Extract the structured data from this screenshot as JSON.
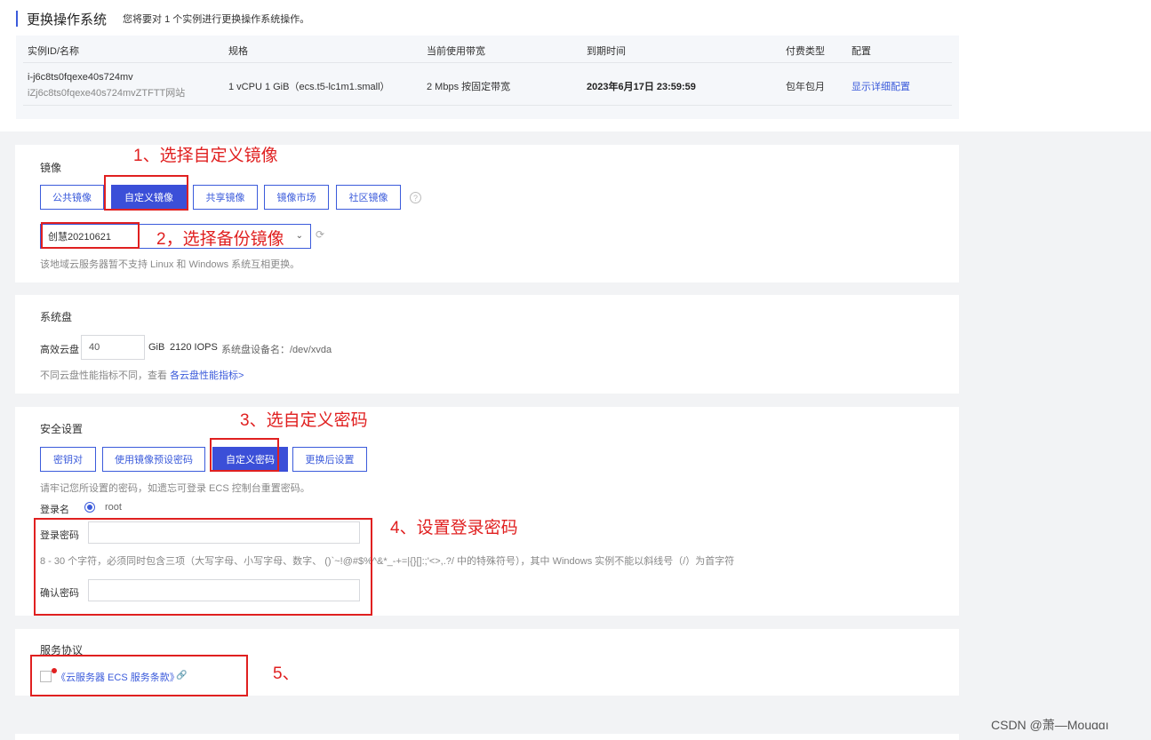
{
  "header": {
    "title": "更换操作系统",
    "subtitle": "您将要对 1 个实例进行更换操作系统操作。"
  },
  "instance_table": {
    "columns": [
      "实例ID/名称",
      "规格",
      "当前使用带宽",
      "到期时间",
      "付费类型",
      "配置"
    ],
    "row": {
      "id": "i-j6c8ts0fqexe40s724mv",
      "name": "iZj6c8ts0fqexe40s724mvZTFTT网站",
      "spec": "1 vCPU 1 GiB（ecs.t5-lc1m1.small）",
      "bandwidth": "2 Mbps 按固定带宽",
      "expire": "2023年6月17日 23:59:59",
      "billing": "包年包月",
      "config_link": "显示详细配置"
    }
  },
  "image": {
    "label": "镜像",
    "tabs": [
      "公共镜像",
      "自定义镜像",
      "共享镜像",
      "镜像市场",
      "社区镜像"
    ],
    "active_tab": "自定义镜像",
    "help_glyph": "?",
    "selected_image": "创慧20210621",
    "hint": "该地域云服务器暂不支持 Linux 和 Windows 系统互相更换。"
  },
  "system_disk": {
    "label": "系统盘",
    "disk_type": "高效云盘",
    "size": "40",
    "unit": "GiB",
    "iops": "2120 IOPS",
    "device": "系统盘设备名：/dev/xvda",
    "hint_prefix": "不同云盘性能指标不同，查看",
    "hint_link": "各云盘性能指标>"
  },
  "security": {
    "label": "安全设置",
    "tabs": [
      "密钥对",
      "使用镜像预设密码",
      "自定义密码",
      "更换后设置"
    ],
    "active_tab": "自定义密码",
    "remember_hint": "请牢记您所设置的密码，如遗忘可登录 ECS 控制台重置密码。",
    "login_name_label": "登录名",
    "login_name": "root",
    "password_label": "登录密码",
    "password_rule": "8 - 30 个字符，必须同时包含三项（大写字母、小写字母、数字、 ()`~!@#$%^&*_-+=|{}[]:;'<>,.?/ 中的特殊符号），其中 Windows 实例不能以斜线号（/）为首字符",
    "confirm_label": "确认密码"
  },
  "agreement": {
    "label": "服务协议",
    "link": "《云服务器 ECS 服务条款》",
    "link_glyph": "🔗"
  },
  "annotations": [
    "1、选择自定义镜像",
    "2，选择备份镜像",
    "3、选自定义密码",
    "4、设置登录密码",
    "5、"
  ],
  "watermark": "CSDN @萧—Mouɑɑı",
  "colors": {
    "primary": "#3b5bdb",
    "annotation": "#e02020",
    "background": "#f2f3f5"
  }
}
